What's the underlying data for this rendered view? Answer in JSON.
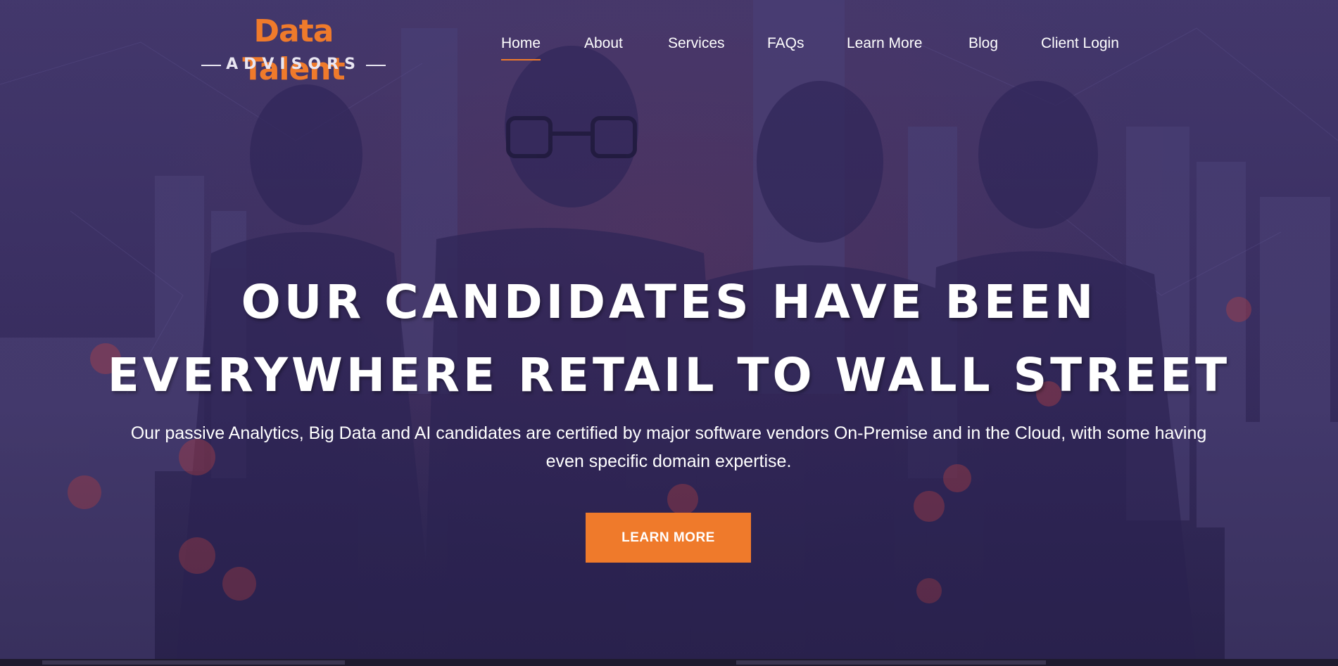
{
  "logo": {
    "brand_top": "Data Talent",
    "brand_bottom": "ADVISORS"
  },
  "nav": {
    "items": [
      {
        "label": "Home",
        "active": true
      },
      {
        "label": "About"
      },
      {
        "label": "Services"
      },
      {
        "label": "FAQs"
      },
      {
        "label": "Learn More"
      },
      {
        "label": "Blog"
      },
      {
        "label": "Client Login"
      }
    ]
  },
  "hero": {
    "headline_line1": "OUR CANDIDATES HAVE BEEN",
    "headline_line2": "EVERYWHERE RETAIL TO WALL STREET",
    "subtext": "Our passive Analytics, Big Data and AI candidates are certified by major software vendors On-Premise and in the Cloud, with some having even specific domain expertise.",
    "cta_label": "LEARN MORE"
  },
  "colors": {
    "accent": "#ef7a2b",
    "overlay": "#3c3163",
    "text": "#ffffff"
  }
}
